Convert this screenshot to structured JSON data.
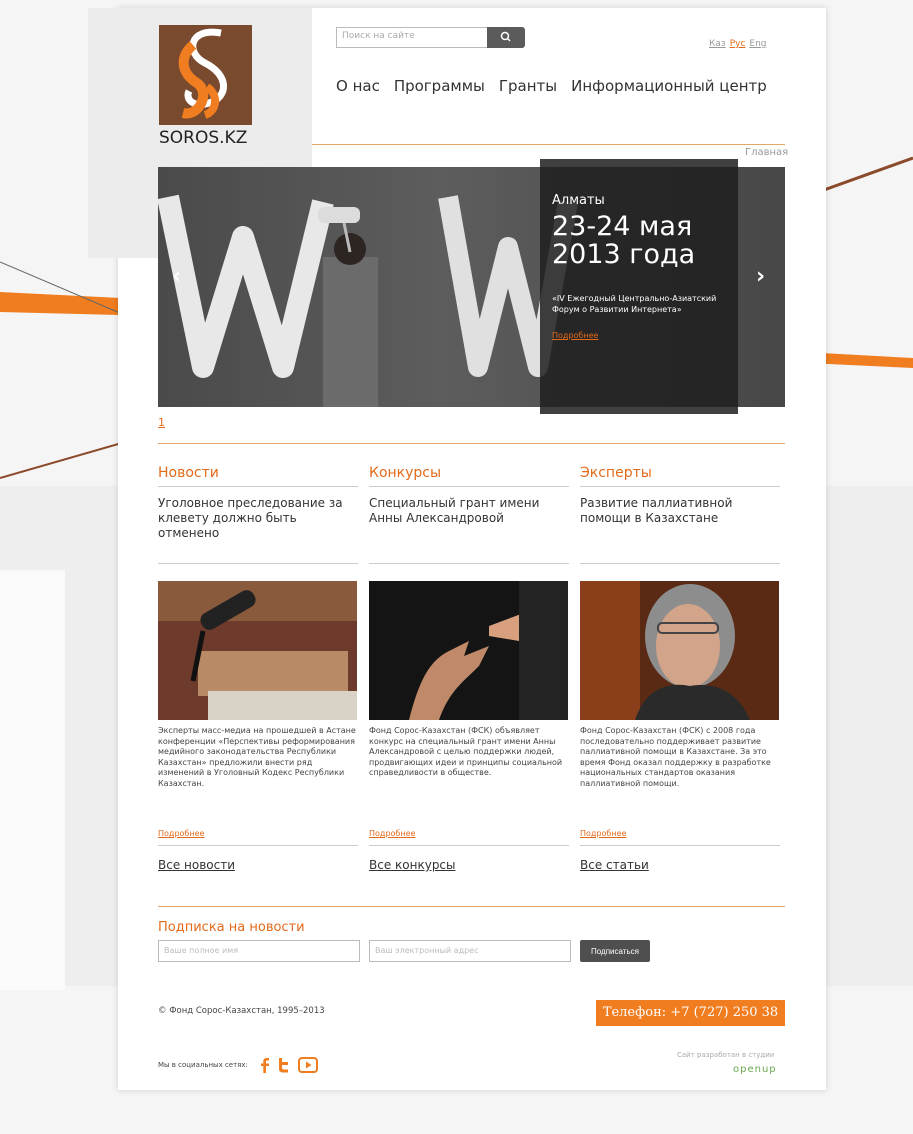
{
  "header": {
    "logo_text": "SOROS.KZ",
    "search": {
      "placeholder": "Поиск на сайте"
    },
    "languages": [
      "Каз",
      "Рус",
      "Eng"
    ],
    "nav": [
      "О нас",
      "Программы",
      "Гранты",
      "Информационный центр"
    ],
    "breadcrumb": "Главная"
  },
  "hero": {
    "city": "Алматы",
    "date": "23-24 мая 2013 года",
    "description": "«IV Ежегодный Центрально-Азиатский Форум о Развитии Интернета»",
    "more_label": "Подробнее",
    "page_number": "1"
  },
  "columns": [
    {
      "heading": "Новости",
      "title": "Уголовное преследование за клевету должно быть отменено",
      "image_icon": "microphone-conference-photo",
      "text": "Эксперты масс-медиа на прошедшей в Астане конференции «Перспективы реформирования медийного законодательства Республики Казахстан» предложили внести ряд изменений в Уголовный Кодекс Республики Казахстан.",
      "more_label": "Подробнее",
      "all_label": "Все новости"
    },
    {
      "heading": "Конкурсы",
      "title": "Специальный грант имени Анны Александровой",
      "image_icon": "hands-photo",
      "text": "Фонд Сорос-Казахстан (ФСК) объявляет конкурс на специальный грант имени Анны Александровой с целью поддержки людей, продвигающих идеи и принципы социальной справедливости в обществе.",
      "more_label": "Подробнее",
      "all_label": "Все конкурсы"
    },
    {
      "heading": "Эксперты",
      "title": "Развитие паллиативной помощи в Казахстане",
      "image_icon": "expert-portrait-photo",
      "text": "Фонд Сорос-Казахстан (ФСК) с 2008 года последовательно поддерживает развитие паллиативной помощи в Казахстане. За это время Фонд оказал поддержку в разработке национальных стандартов оказания паллиативной помощи.",
      "more_label": "Подробнее",
      "all_label": "Все статьи"
    }
  ],
  "subscribe": {
    "heading": "Подписка на новости",
    "name_placeholder": "Ваше полное имя",
    "email_placeholder": "Ваш электронный адрес",
    "button_label": "Подписаться"
  },
  "footer": {
    "copyright": "© Фонд Сорос-Казахстан, 1995–2013",
    "phone": "Телефон: +7 (727) 250 38 11",
    "social_label": "Мы в социальных сетях:",
    "developer_label": "Сайт разработан в студии",
    "developer_logo": "openup"
  },
  "colors": {
    "accent": "#e36a1a",
    "phone_bg": "#f07d20",
    "logo_bg": "#7a4a2f"
  }
}
